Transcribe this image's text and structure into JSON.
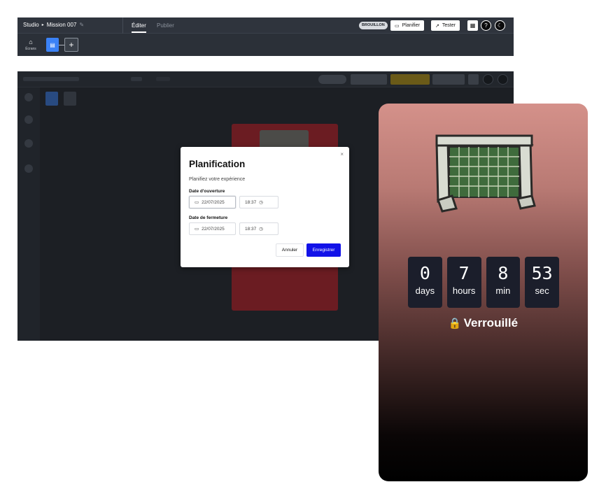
{
  "header": {
    "breadcrumb_root": "Studio",
    "breadcrumb_sep": "▸",
    "project_name": "Mission 007",
    "tabs": [
      {
        "label": "Éditer"
      },
      {
        "label": "Publier"
      }
    ],
    "status_badge": "BROUILLON",
    "schedule_label": "Planifier",
    "test_label": "Tester"
  },
  "toolbar": {
    "screens_label": "Écrans"
  },
  "modal": {
    "title": "Planification",
    "subtitle": "Planifiez votre expérience",
    "open_label": "Date d'ouverture",
    "open_date": "22/07/2025",
    "open_time": "18:37",
    "close_label": "Date de fermeture",
    "close_date": "22/07/2025",
    "close_time": "18:37",
    "cancel_label": "Annuler",
    "save_label": "Enregistrer",
    "close_icon": "×"
  },
  "preview": {
    "countdown": [
      {
        "value": "0",
        "unit": "days"
      },
      {
        "value": "7",
        "unit": "hours"
      },
      {
        "value": "8",
        "unit": "min"
      },
      {
        "value": "53",
        "unit": "sec"
      }
    ],
    "locked_label": "Verrouillé"
  },
  "colors": {
    "primary": "#1212e8",
    "accent_blue": "#3b82f6",
    "countdown_bg": "#1b1e2b"
  },
  "icons": [
    "pencil-icon",
    "calendar-icon",
    "external-link-icon",
    "qr-code-icon",
    "help-icon",
    "moon-icon",
    "screens-icon",
    "page-icon",
    "plus-icon",
    "clock-icon",
    "lock-icon",
    "goal-image"
  ]
}
